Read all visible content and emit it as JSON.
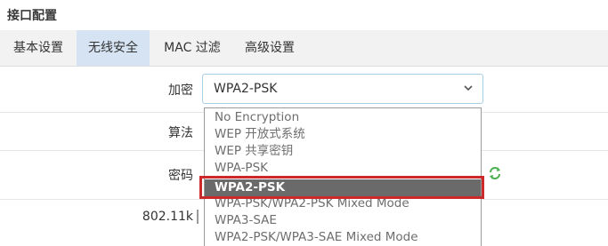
{
  "page": {
    "title": "接口配置"
  },
  "tabs": [
    {
      "label": "基本设置",
      "active": false
    },
    {
      "label": "无线安全",
      "active": true
    },
    {
      "label": "MAC 过滤",
      "active": false
    },
    {
      "label": "高级设置",
      "active": false
    }
  ],
  "form": {
    "encryption_label": "加密",
    "encryption_value": "WPA2-PSK",
    "algorithm_label": "算法",
    "password_label": "密码",
    "dot11k_label": "802.11k"
  },
  "dropdown": {
    "options": [
      "No Encryption",
      "WEP 开放式系统",
      "WEP 共享密钥",
      "WPA-PSK",
      "WPA2-PSK",
      "WPA-PSK/WPA2-PSK Mixed Mode",
      "WPA3-SAE",
      "WPA2-PSK/WPA3-SAE Mixed Mode"
    ],
    "selected": "WPA2-PSK"
  },
  "icons": {
    "select_arrow": "chevron-down-icon",
    "refresh": "refresh-icon"
  },
  "colors": {
    "active_tab": "#d5e3f3",
    "select_border": "#aacfe8",
    "highlight": "#cc2a2a",
    "selected_option": "#6a6a6a",
    "refresh_icon": "#4caf50"
  }
}
